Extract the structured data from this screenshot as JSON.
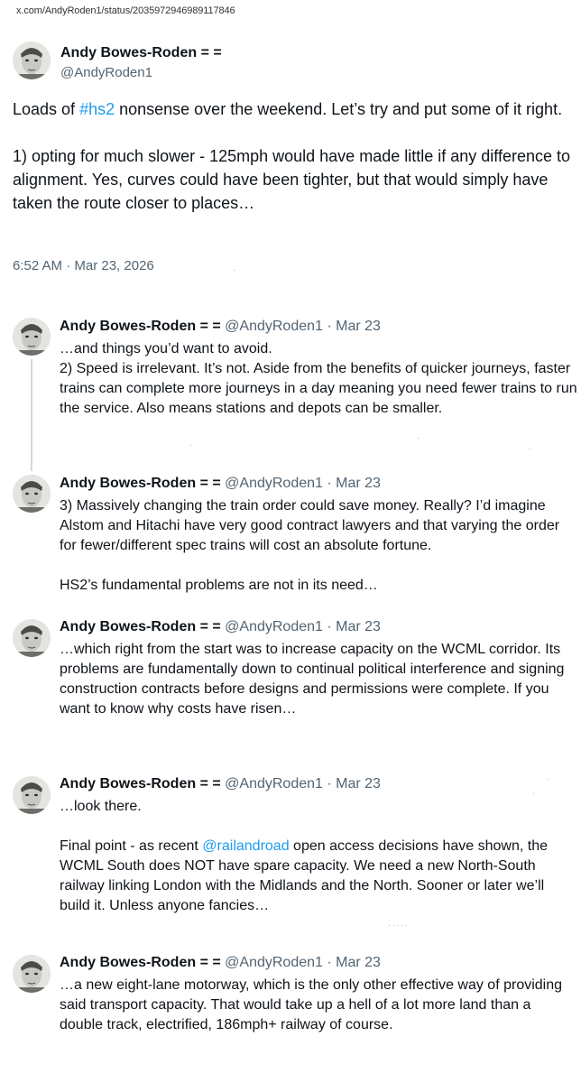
{
  "url": "x.com/AndyRoden1/status/2035972946989117846",
  "author": {
    "name": "Andy Bowes-Roden = =",
    "handle": "@AndyRoden1"
  },
  "main_tweet": {
    "text_before_tag": "Loads of ",
    "hashtag": "#hs2",
    "text_after_tag": " nonsense over the weekend. Let’s try and put some of it right.",
    "paragraph2": "1) opting for much slower - 125mph would have made little if any difference to alignment. Yes, curves could have been tighter, but that would simply have taken the route closer to places…",
    "timestamp": "6:52 AM · Mar 23, 2026"
  },
  "replies": [
    {
      "meta": "@AndyRoden1 · Mar 23",
      "p1": "…and things you’d want to avoid.",
      "p2": "2) Speed is irrelevant. It’s not. Aside from the benefits of quicker journeys, faster trains can complete more journeys in a day meaning you need fewer trains to run the service. Also means stations and depots can be smaller."
    },
    {
      "meta": "@AndyRoden1 · Mar 23",
      "p1": "3) Massively changing the train order could save money. Really? I’d imagine Alstom and Hitachi have very good contract lawyers and that varying the order for fewer/different spec trains will cost an absolute fortune.",
      "p2": "HS2’s fundamental problems are not in its need…"
    },
    {
      "meta": "@AndyRoden1 · Mar 23",
      "p1": "…which right from the start was to increase capacity on the WCML corridor. Its problems are fundamentally down to continual political interference and signing construction contracts before designs and permissions were complete. If you want to know why costs have risen…"
    },
    {
      "meta": "@AndyRoden1 · Mar 23",
      "p1": "…look there.",
      "p2_before": "Final point - as recent ",
      "p2_mention": "@railandroad",
      "p2_after": " open access decisions have shown, the WCML South does NOT have spare capacity. We need a new North-South railway linking London with the Midlands and the North. Sooner or later we’ll build it. Unless anyone fancies…"
    },
    {
      "meta": "@AndyRoden1 · Mar 23",
      "p1": "…a new eight-lane motorway, which is the only other effective way of providing said transport capacity. That would take up a hell of a lot more land than a double track, electrified, 186mph+ railway of course."
    }
  ],
  "colors": {
    "text": "#0f1419",
    "secondary": "#536471",
    "link": "#1d9bf0",
    "thread_line": "#cfd9de"
  }
}
